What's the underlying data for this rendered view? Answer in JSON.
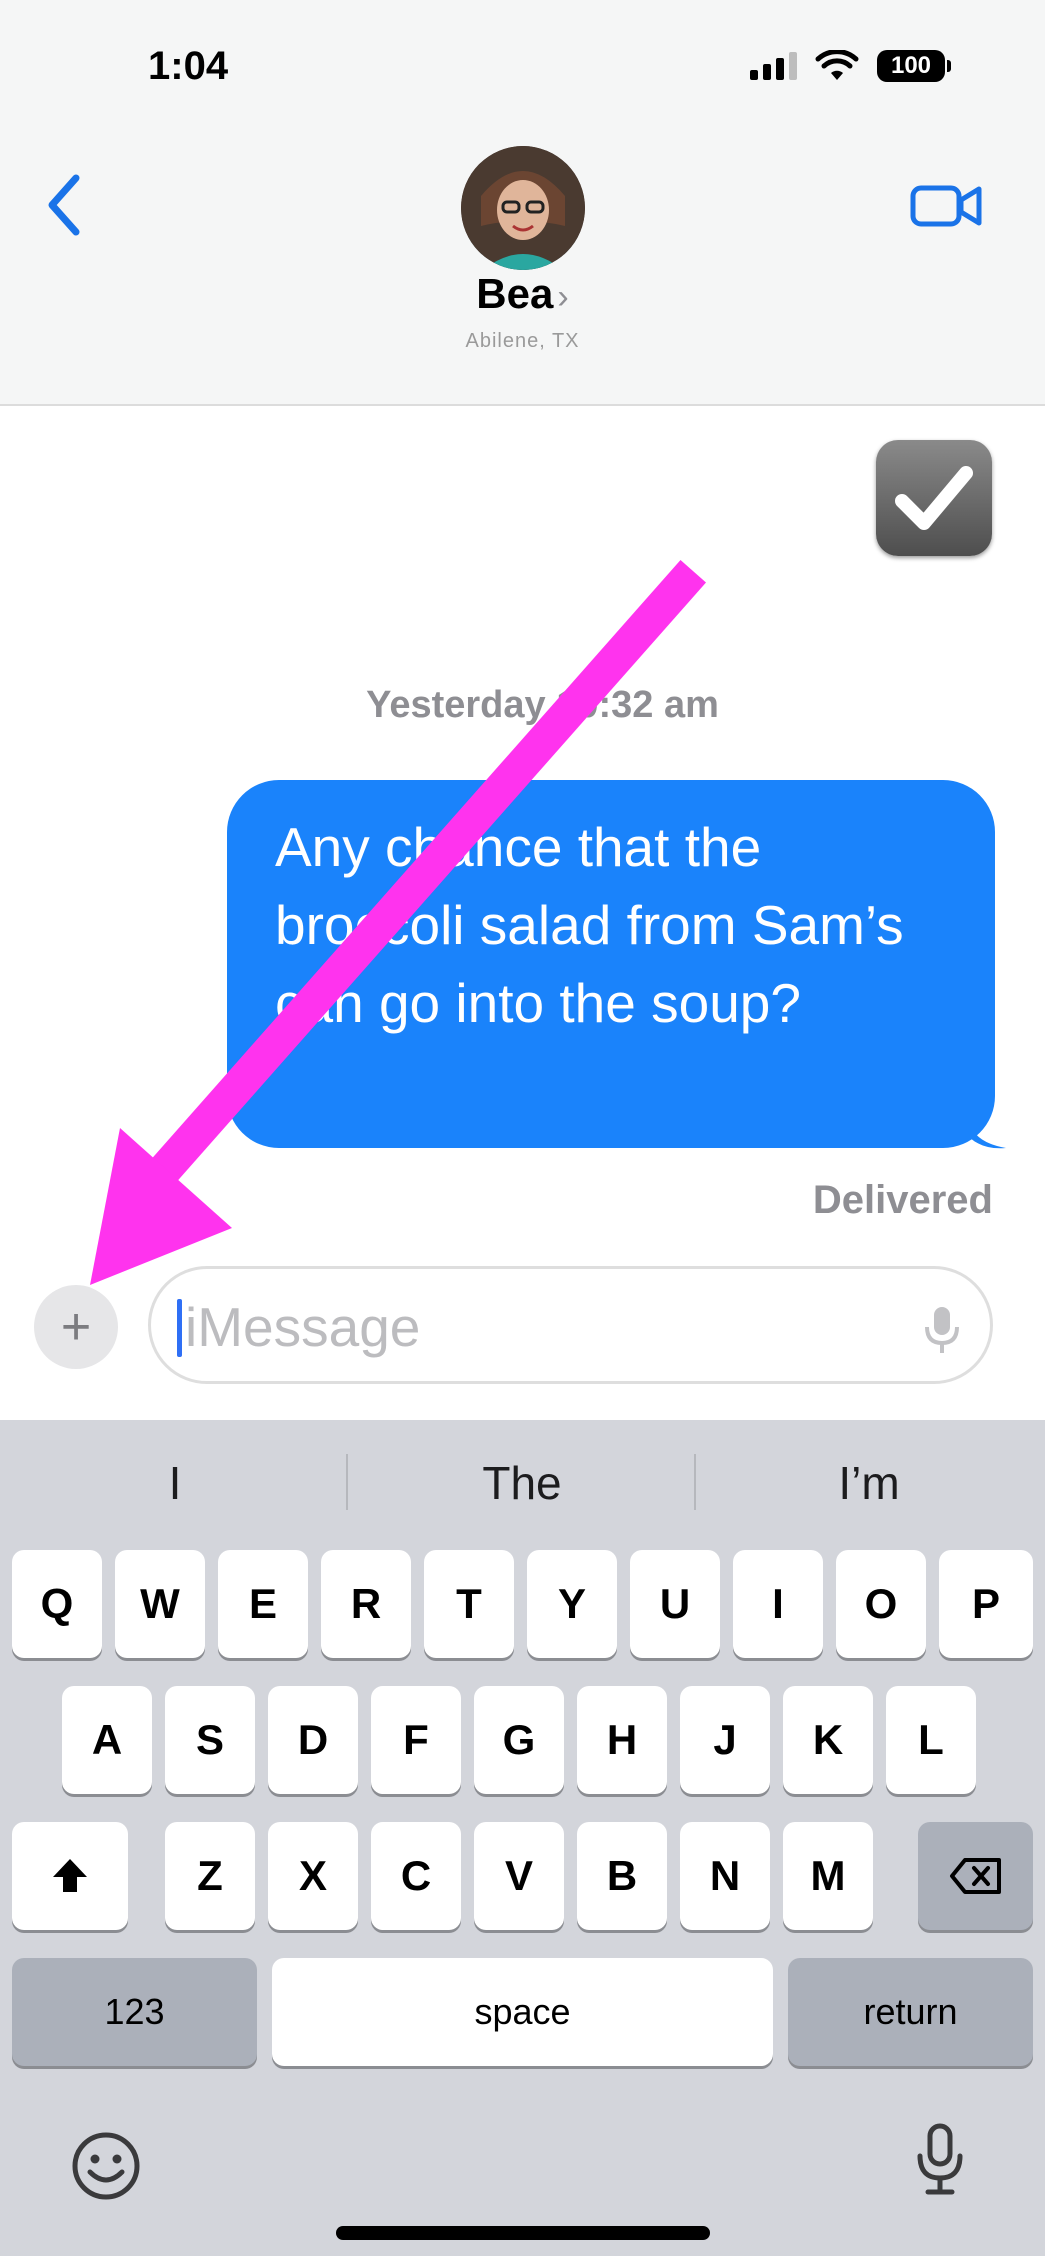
{
  "status_bar": {
    "time": "1:04",
    "battery": "100"
  },
  "header": {
    "contact_name": "Bea",
    "contact_chevron": "›",
    "contact_location": "Abilene, TX",
    "icons": [
      "chevron-left-icon",
      "video-camera-icon",
      "avatar"
    ]
  },
  "conversation": {
    "sticker": "checkmark",
    "timestamp": "Yesterday 10:32 am",
    "message": "Any chance that the broccoli salad from Sam’s can go into the soup?",
    "delivery_status": "Delivered"
  },
  "composer": {
    "plus_label": "+",
    "placeholder": "iMessage"
  },
  "keyboard": {
    "suggestions": [
      "I",
      "The",
      "I’m"
    ],
    "row1": [
      "Q",
      "W",
      "E",
      "R",
      "T",
      "Y",
      "U",
      "I",
      "O",
      "P"
    ],
    "row2": [
      "A",
      "S",
      "D",
      "F",
      "G",
      "H",
      "J",
      "K",
      "L"
    ],
    "row3": [
      "Z",
      "X",
      "C",
      "V",
      "B",
      "N",
      "M"
    ],
    "numbers_label": "123",
    "space_label": "space",
    "return_label": "return"
  },
  "colors": {
    "bubble": "#1a83fb",
    "accent": "#1a73e8",
    "annotation_arrow": "#ff33ee"
  }
}
